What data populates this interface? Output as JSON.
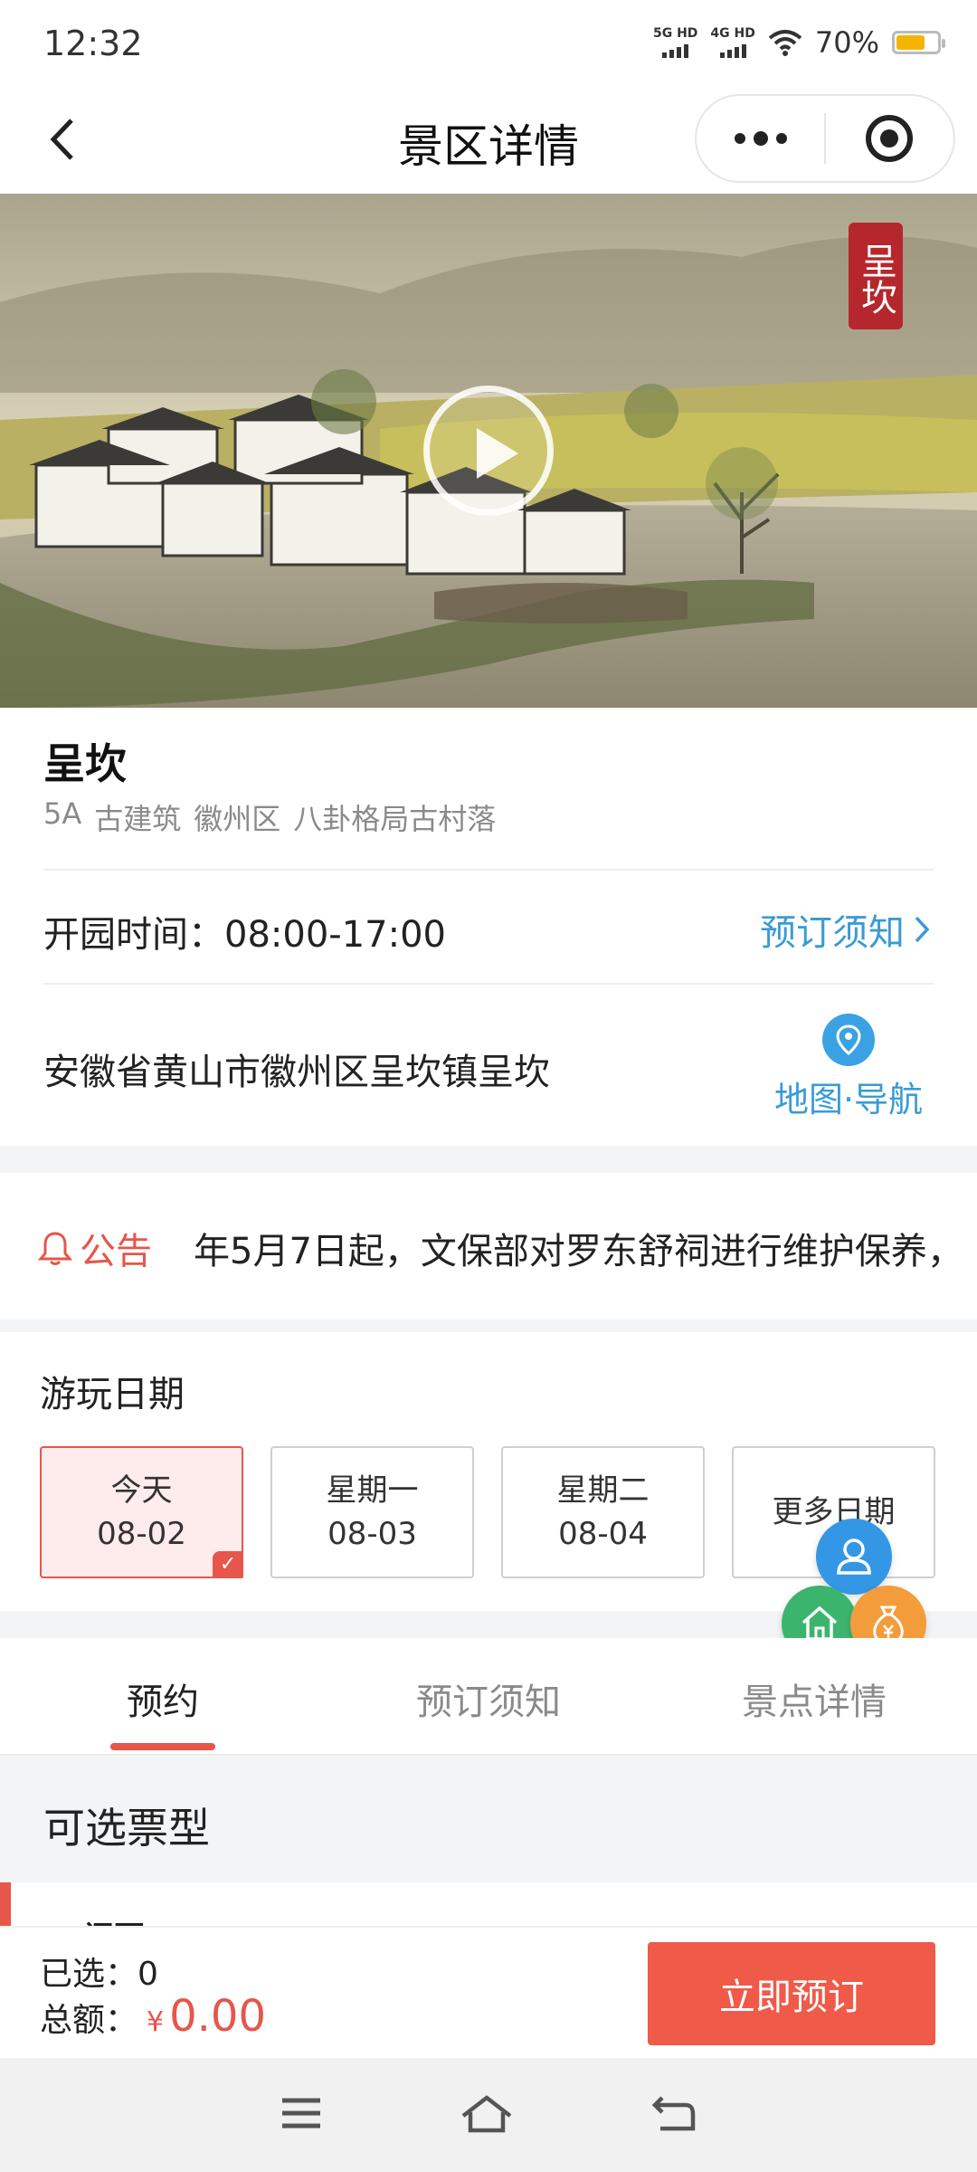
{
  "status_bar": {
    "time": "12:32",
    "net1": "5G HD",
    "net2": "4G HD",
    "battery": "70%",
    "battery_level": 0.7
  },
  "header": {
    "title": "景区详情",
    "back_icon": "chevron-left-icon",
    "more_icon": "more-dots-icon",
    "close_icon": "target-icon"
  },
  "hero": {
    "seal_text": "呈坎",
    "play_icon": "play-icon"
  },
  "scenic": {
    "name": "呈坎",
    "tags": [
      "5A",
      "古建筑",
      "徽州区",
      "八卦格局古村落"
    ],
    "open_time": "开园时间：08:00-17:00",
    "booking_link": "预订须知",
    "address": "安徽省黄山市徽州区呈坎镇呈坎",
    "map_nav": "地图·导航"
  },
  "notice": {
    "label": "公告",
    "text": "年5月7日起，文保部对罗东舒祠进行维护保养，"
  },
  "dates": {
    "label": "游玩日期",
    "items": [
      {
        "line1": "今天",
        "line2": "08-02",
        "selected": true
      },
      {
        "line1": "星期一",
        "line2": "08-03",
        "selected": false
      },
      {
        "line1": "星期二",
        "line2": "08-04",
        "selected": false
      },
      {
        "line1": "更多日期",
        "line2": "",
        "selected": false
      }
    ]
  },
  "tabs": [
    "预约",
    "预订须知",
    "景点详情"
  ],
  "tickets": {
    "title": "可选票型",
    "partial_item": "门票"
  },
  "bottom_bar": {
    "selected_label": "已选：",
    "selected_count": "0",
    "total_label": "总额：",
    "currency": "¥",
    "total_amount": "0.00",
    "book_button": "立即预订"
  },
  "colors": {
    "accent": "#e6564a",
    "link": "#3a9bd5",
    "button": "#ef5a49"
  }
}
